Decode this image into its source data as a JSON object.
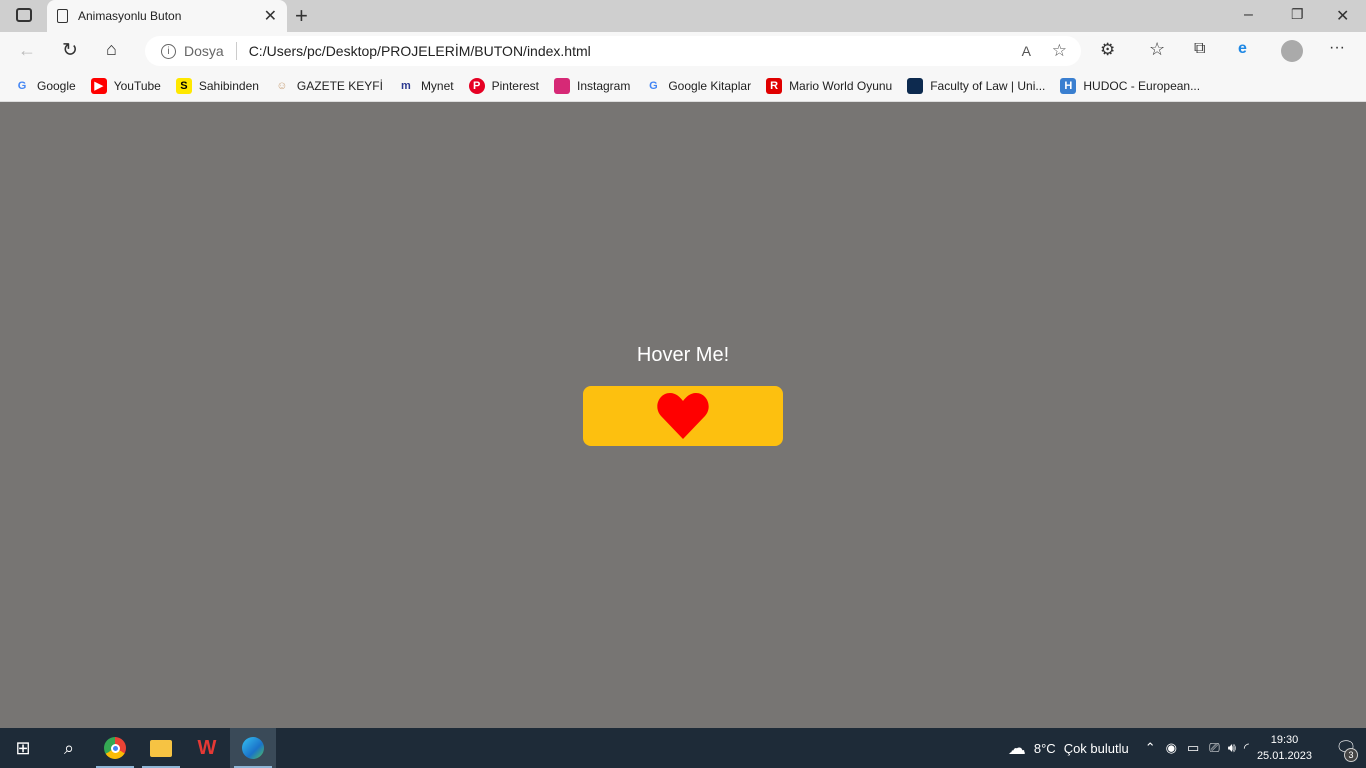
{
  "browser": {
    "tab_title": "Animasyonlu Buton",
    "address_label": "Dosya",
    "url": "C:/Users/pc/Desktop/PROJELERİM/BUTON/index.html",
    "bookmarks": [
      {
        "label": "Google",
        "icon": "google-icon",
        "color": "#4285f4"
      },
      {
        "label": "YouTube",
        "icon": "youtube-icon",
        "color": "#ff0000"
      },
      {
        "label": "Sahibinden",
        "icon": "sahibinden-icon",
        "color": "#ffe800"
      },
      {
        "label": "GAZETE KEYFİ",
        "icon": "gazete-icon",
        "color": "#c9a27a"
      },
      {
        "label": "Mynet",
        "icon": "mynet-icon",
        "color": "#2b3990"
      },
      {
        "label": "Pinterest",
        "icon": "pinterest-icon",
        "color": "#e60023"
      },
      {
        "label": "Instagram",
        "icon": "instagram-icon",
        "color": "#d62976"
      },
      {
        "label": "Google Kitaplar",
        "icon": "google-icon",
        "color": "#4285f4"
      },
      {
        "label": "Mario World Oyunu",
        "icon": "mario-icon",
        "color": "#e00000"
      },
      {
        "label": "Faculty of Law | Uni...",
        "icon": "faculty-icon",
        "color": "#0d2a4f"
      },
      {
        "label": "HUDOC - European...",
        "icon": "hudoc-icon",
        "color": "#3a7fd0"
      }
    ]
  },
  "page": {
    "hover_text": "Hover Me!",
    "button_color": "#fdc00f",
    "heart_color": "#ff0000"
  },
  "taskbar": {
    "temperature": "8°C",
    "weather": "Çok bulutlu",
    "time": "19:30",
    "date": "25.01.2023",
    "notifications": "3"
  }
}
